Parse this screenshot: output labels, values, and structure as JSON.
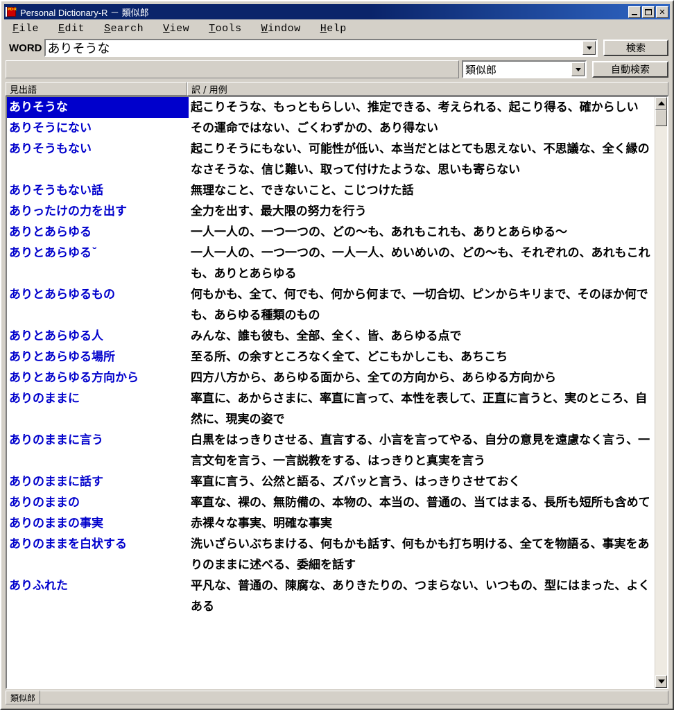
{
  "window": {
    "title": "Personal Dictionary-R － 類似郎",
    "icon": "book-icon",
    "icon_text": "PD·R",
    "controls": {
      "minimize": "_",
      "maximize": "□",
      "close": "✕"
    }
  },
  "menu": [
    {
      "accel": "F",
      "rest": "ile"
    },
    {
      "accel": "E",
      "rest": "dit"
    },
    {
      "accel": "S",
      "rest": "earch"
    },
    {
      "accel": "V",
      "rest": "iew"
    },
    {
      "accel": "T",
      "rest": "ools"
    },
    {
      "accel": "W",
      "rest": "indow"
    },
    {
      "accel": "H",
      "rest": "elp"
    }
  ],
  "toolbar": {
    "word_label": "WORD",
    "word_value": "ありそうな",
    "search_button": "検索",
    "dictionary_value": "類似郎",
    "auto_search_button": "自動検索"
  },
  "list": {
    "columns": [
      "見出語",
      "訳 / 用例"
    ],
    "rows": [
      {
        "term": "ありそうな",
        "definition": "起こりそうな、もっともらしい、推定できる、考えられる、起こり得る、確からしい",
        "selected": true
      },
      {
        "term": "ありそうにない",
        "definition": "その運命ではない、ごくわずかの、あり得ない",
        "selected": false
      },
      {
        "term": "ありそうもない",
        "definition": "起こりそうにもない、可能性が低い、本当だとはとても思えない、不思議な、全く縁のなさそうな、信じ難い、取って付けたような、思いも寄らない",
        "selected": false
      },
      {
        "term": "ありそうもない話",
        "definition": "無理なこと、できないこと、こじつけた話",
        "selected": false
      },
      {
        "term": "ありったけの力を出す",
        "definition": "全力を出す、最大限の努力を行う",
        "selected": false
      },
      {
        "term": "ありとあらゆる",
        "definition": "一人一人の、一つ一つの、どの～も、あれもこれも、ありとあらゆる～",
        "selected": false
      },
      {
        "term": "ありとあらゆる˘",
        "definition": "一人一人の、一つ一つの、一人一人、めいめいの、どの～も、それぞれの、あれもこれも、ありとあらゆる",
        "selected": false
      },
      {
        "term": "ありとあらゆるもの",
        "definition": "何もかも、全て、何でも、何から何まで、一切合切、ピンからキリまで、そのほか何でも、あらゆる種類のもの",
        "selected": false
      },
      {
        "term": "ありとあらゆる人",
        "definition": "みんな、誰も彼も、全部、全く、皆、あらゆる点で",
        "selected": false
      },
      {
        "term": "ありとあらゆる場所",
        "definition": "至る所、の余すところなく全て、どこもかしこも、あちこち",
        "selected": false
      },
      {
        "term": "ありとあらゆる方向から",
        "definition": "四方八方から、あらゆる面から、全ての方向から、あらゆる方向から",
        "selected": false
      },
      {
        "term": "ありのままに",
        "definition": "率直に、あからさまに、率直に言って、本性を表して、正直に言うと、実のところ、自然に、現実の姿で",
        "selected": false
      },
      {
        "term": "ありのままに言う",
        "definition": "白黒をはっきりさせる、直言する、小言を言ってやる、自分の意見を遠慮なく言う、一言文句を言う、一言説教をする、はっきりと真実を言う",
        "selected": false
      },
      {
        "term": "ありのままに話す",
        "definition": "率直に言う、公然と語る、ズバッと言う、はっきりさせておく",
        "selected": false
      },
      {
        "term": "ありのままの",
        "definition": "率直な、裸の、無防備の、本物の、本当の、普通の、当てはまる、長所も短所も含めて",
        "selected": false
      },
      {
        "term": "ありのままの事実",
        "definition": "赤裸々な事実、明確な事実",
        "selected": false
      },
      {
        "term": "ありのままを白状する",
        "definition": "洗いざらいぶちまける、何もかも話す、何もかも打ち明ける、全てを物語る、事実をありのままに述べる、委細を話す",
        "selected": false
      },
      {
        "term": "ありふれた",
        "definition": "平凡な、普通の、陳腐な、ありきたりの、つまらない、いつもの、型にはまった、よくある",
        "selected": false
      }
    ]
  },
  "status": {
    "tab": "類似郎"
  },
  "colors": {
    "title_bar": "#0a246a",
    "face": "#d4d0c8",
    "term_text": "#0000cc",
    "selection": "#0000cc"
  }
}
